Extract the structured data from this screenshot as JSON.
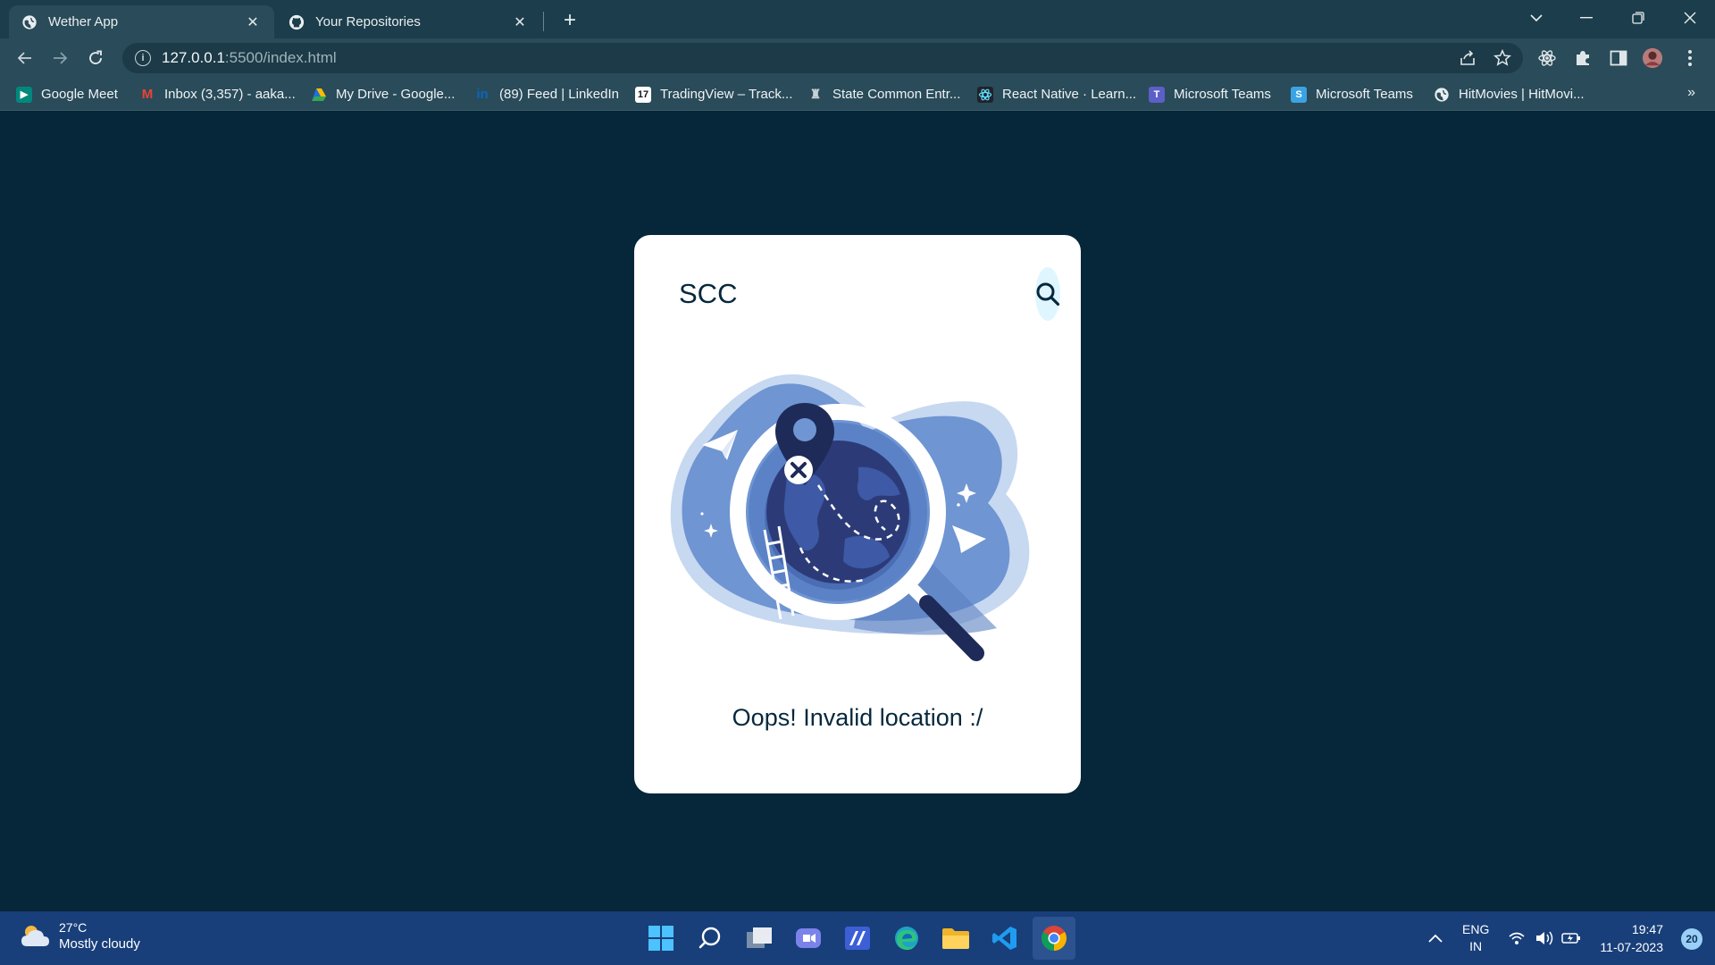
{
  "browser": {
    "tabs": [
      {
        "title": "Wether App",
        "icon": "globe-icon",
        "active": true
      },
      {
        "title": "Your Repositories",
        "icon": "github-icon",
        "active": false
      }
    ],
    "address": {
      "host": "127.0.0.1",
      "path": ":5500/index.html"
    },
    "bookmarks": [
      {
        "label": "Google Meet",
        "icon": "google-meet-icon",
        "color": "#00897b"
      },
      {
        "label": "Inbox (3,357) - aaka...",
        "icon": "gmail-icon",
        "color": "#d93025"
      },
      {
        "label": "My Drive - Google...",
        "icon": "google-drive-icon",
        "color": "#1a73e8"
      },
      {
        "label": "(89) Feed | LinkedIn",
        "icon": "linkedin-icon",
        "color": "#0a66c2"
      },
      {
        "label": "TradingView – Track...",
        "icon": "tradingview-icon",
        "color": "#131722"
      },
      {
        "label": "State Common Entr...",
        "icon": "emblem-icon",
        "color": "#3b4a52"
      },
      {
        "label": "React Native · Learn...",
        "icon": "react-icon",
        "color": "#20232a"
      },
      {
        "label": "Microsoft Teams",
        "icon": "teams-icon",
        "color": "#5b5fc7"
      },
      {
        "label": "Microsoft Teams",
        "icon": "teams-s-icon",
        "color": "#3aa3e3"
      },
      {
        "label": "HitMovies | HitMovi...",
        "icon": "globe-icon",
        "color": "#6a8591"
      }
    ],
    "bookmarks_more": "»"
  },
  "app": {
    "search": {
      "value": "SCC",
      "placeholder": ""
    },
    "error_message": "Oops! Invalid location :/",
    "colors": {
      "page_bg": "#06263a",
      "card_bg": "#ffffff",
      "accent": "#06283d",
      "search_btn_bg": "#dff6ff"
    }
  },
  "taskbar": {
    "weather": {
      "temp": "27°C",
      "condition": "Mostly cloudy"
    },
    "apps": [
      "windows-start-icon",
      "search-icon",
      "task-view-icon",
      "teams-chat-icon",
      "paint-icon",
      "edge-icon",
      "file-explorer-icon",
      "vscode-icon",
      "chrome-icon"
    ],
    "language": {
      "lang": "ENG",
      "region": "IN"
    },
    "clock": {
      "time": "19:47",
      "date": "11-07-2023"
    },
    "notifications": "20"
  }
}
